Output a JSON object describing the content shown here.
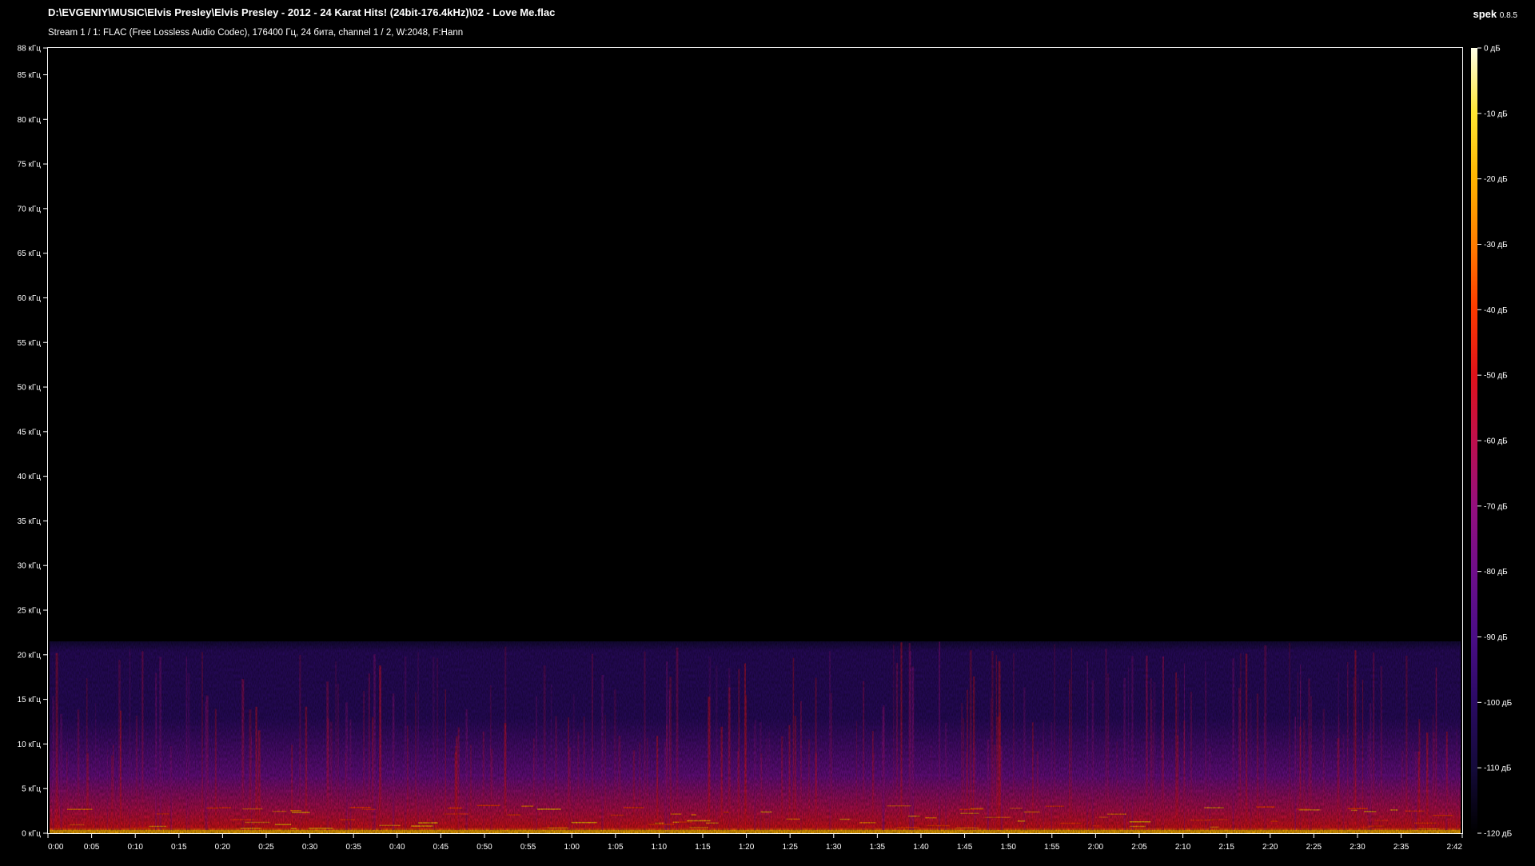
{
  "header": {
    "file_path": "D:\\EVGENIY\\MUSIC\\Elvis Presley\\Elvis Presley - 2012 - 24 Karat Hits! (24bit-176.4kHz)\\02 - Love Me.flac",
    "stream_info": "Stream 1 / 1: FLAC (Free Lossless Audio Codec), 176400 Гц, 24 бита, channel 1 / 2, W:2048, F:Hann",
    "app_name": "spek",
    "app_version": "0.8.5"
  },
  "colors": {
    "background": "#000000",
    "foreground": "#ffffff",
    "palette": [
      "#000000",
      "#140a3a",
      "#2a0a63",
      "#4a0d87",
      "#6e0e8a",
      "#940f7d",
      "#bd0f4c",
      "#e0121a",
      "#fb3a00",
      "#ff7d00",
      "#ffb400",
      "#ffe632",
      "#ffffe6"
    ]
  },
  "chart_data": {
    "type": "heatmap",
    "title": "D:\\EVGENIY\\MUSIC\\Elvis Presley\\Elvis Presley - 2012 - 24 Karat Hits! (24bit-176.4kHz)\\02 - Love Me.flac",
    "subtitle": "Stream 1 / 1: FLAC (Free Lossless Audio Codec), 176400 Гц, 24 бита, channel 1 / 2, W:2048, F:Hann",
    "x_unit": "time (m:ss)",
    "xlim": [
      "0:00",
      "2:42"
    ],
    "x_ticks": [
      "0:00",
      "0:05",
      "0:10",
      "0:15",
      "0:20",
      "0:25",
      "0:30",
      "0:35",
      "0:40",
      "0:45",
      "0:50",
      "0:55",
      "1:00",
      "1:05",
      "1:10",
      "1:15",
      "1:20",
      "1:25",
      "1:30",
      "1:35",
      "1:40",
      "1:45",
      "1:50",
      "1:55",
      "2:00",
      "2:05",
      "2:10",
      "2:15",
      "2:20",
      "2:25",
      "2:30",
      "2:35",
      "2:42"
    ],
    "y_unit": "kHz",
    "ylim": [
      0,
      88
    ],
    "y_ticks": [
      "0 кГц",
      "5 кГц",
      "10 кГц",
      "15 кГц",
      "20 кГц",
      "25 кГц",
      "30 кГц",
      "35 кГц",
      "40 кГц",
      "45 кГц",
      "50 кГц",
      "55 кГц",
      "60 кГц",
      "65 кГц",
      "70 кГц",
      "75 кГц",
      "80 кГц",
      "85 кГц",
      "88 кГц"
    ],
    "colorbar": {
      "range_db": [
        -120,
        0
      ],
      "ticks": [
        "0 дБ",
        "-10 дБ",
        "-20 дБ",
        "-30 дБ",
        "-40 дБ",
        "-50 дБ",
        "-60 дБ",
        "-70 дБ",
        "-80 дБ",
        "-90 дБ",
        "-100 дБ",
        "-110 дБ",
        "-120 дБ"
      ]
    },
    "content_cutoff_khz": 21.5,
    "grid": false
  }
}
